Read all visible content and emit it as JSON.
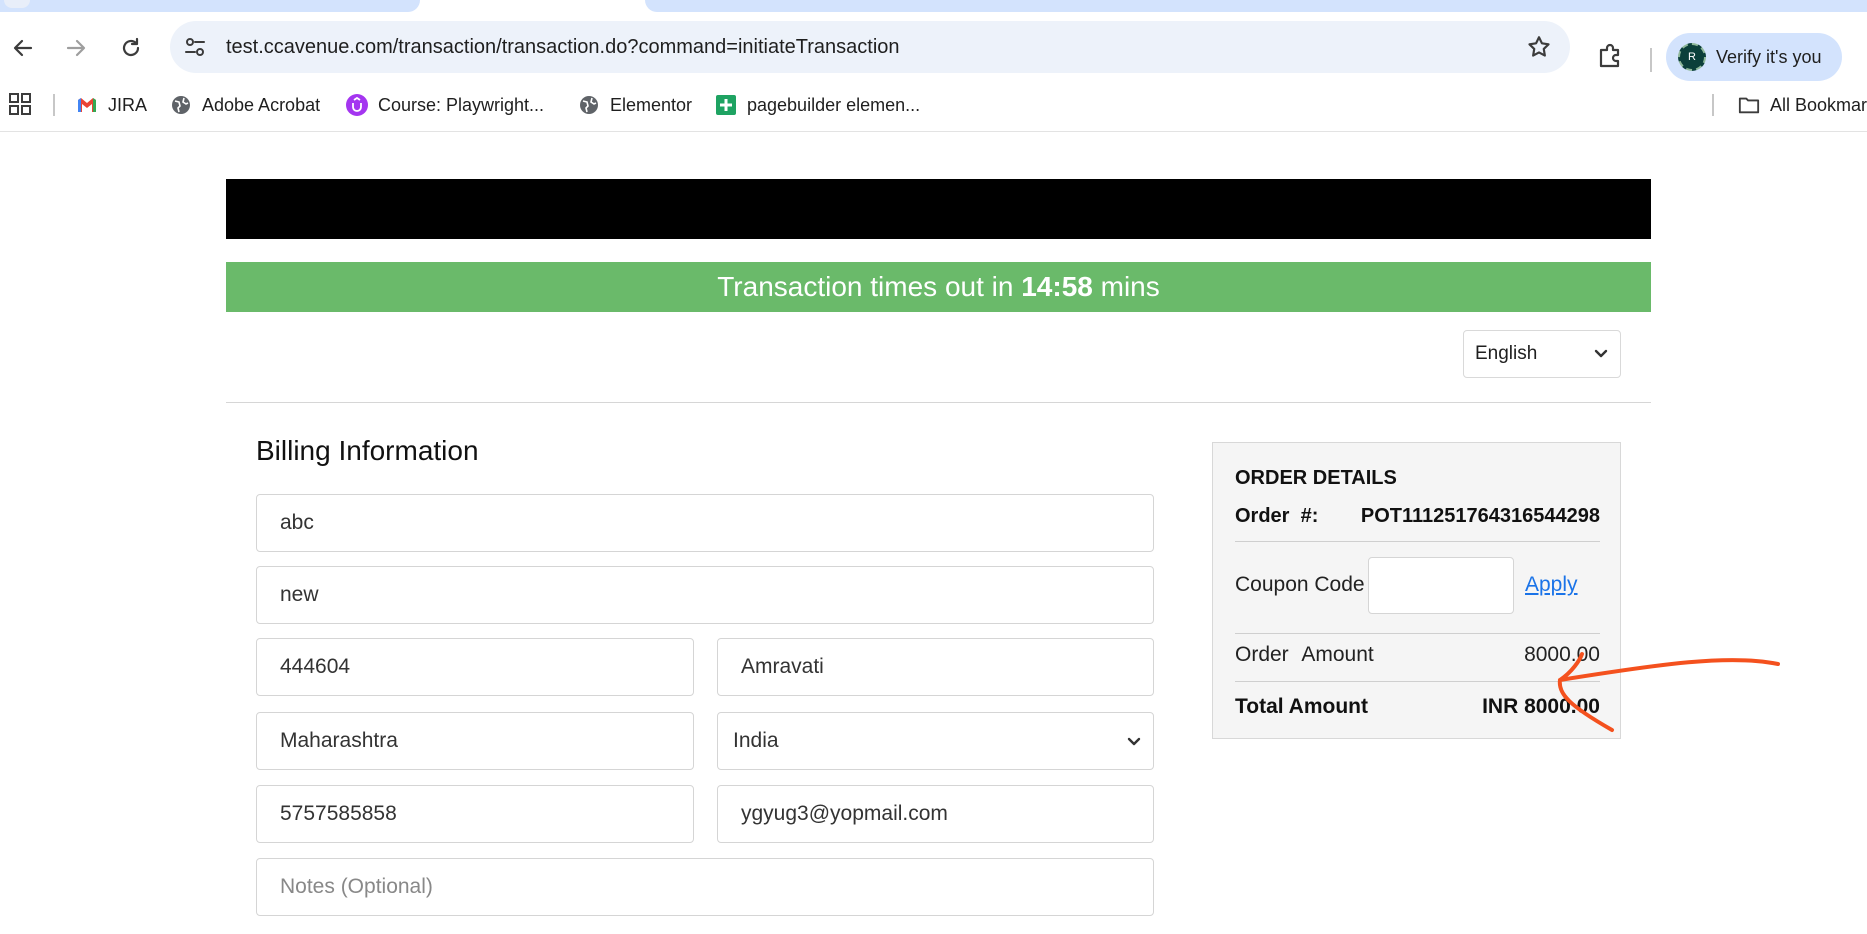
{
  "browser": {
    "url": "test.ccavenue.com/transaction/transaction.do?command=initiateTransaction",
    "profile_initial": "R",
    "profile_label": "Verify it's you",
    "bookmarks": [
      {
        "label": "JIRA",
        "icon": "gmail-icon"
      },
      {
        "label": "Adobe Acrobat",
        "icon": "globe-icon"
      },
      {
        "label": "Course: Playwright...",
        "icon": "udemy-icon"
      },
      {
        "label": "Elementor",
        "icon": "globe-icon"
      },
      {
        "label": "pagebuilder elemen...",
        "icon": "sheets-icon"
      }
    ],
    "all_bookmarks": "All Bookmarks"
  },
  "timer": {
    "prefix": "Transaction times out in",
    "time": "14:58",
    "suffix": "mins",
    "color": "#6aba6a"
  },
  "language": {
    "selected": "English"
  },
  "billing": {
    "title": "Billing Information",
    "name": "abc",
    "address": "new",
    "zip": "444604",
    "city": "Amravati",
    "state": "Maharashtra",
    "country": "India",
    "phone": "5757585858",
    "email": "ygyug3@yopmail.com",
    "notes_placeholder": "Notes (Optional)"
  },
  "order": {
    "title": "ORDER DETAILS",
    "order_label": "Order  #:",
    "order_number": "POT111251764316544298",
    "coupon_label": "Coupon Code",
    "coupon_value": "",
    "apply_label": "Apply",
    "amount_label": "Order Amount",
    "amount_value": "8000.00",
    "total_label": "Total Amount",
    "total_value": "INR 8000.00",
    "link_color": "#1a73e8"
  },
  "annotation_color": "#f4511e"
}
